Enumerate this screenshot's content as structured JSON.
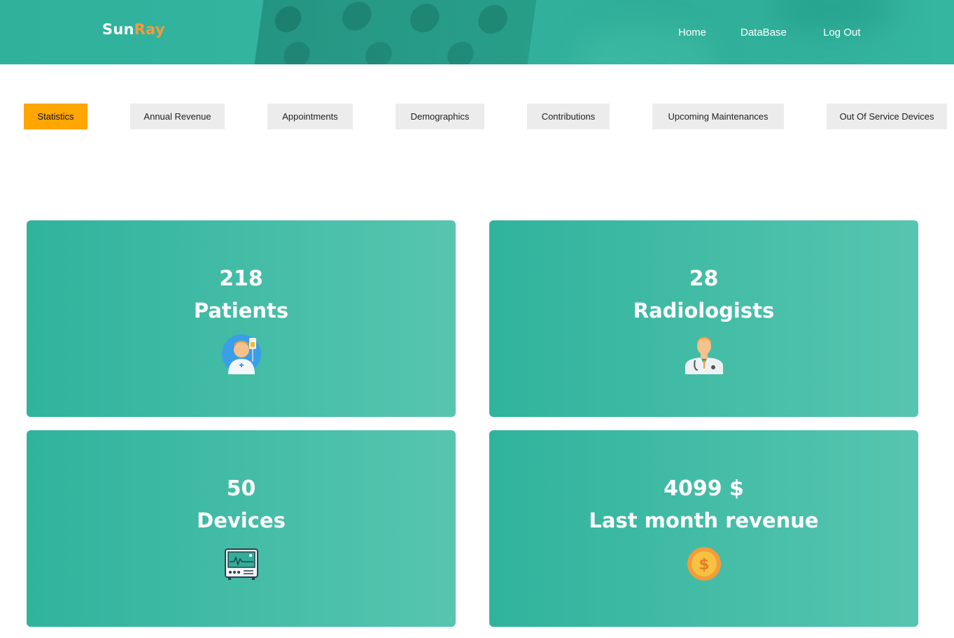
{
  "brand": {
    "part1": "Sun",
    "part2": "Ray"
  },
  "nav": {
    "home": "Home",
    "database": "DataBase",
    "logout": "Log Out"
  },
  "tabs": [
    {
      "label": "Statistics",
      "active": true
    },
    {
      "label": "Annual Revenue",
      "active": false
    },
    {
      "label": "Appointments",
      "active": false
    },
    {
      "label": "Demographics",
      "active": false
    },
    {
      "label": "Contributions",
      "active": false
    },
    {
      "label": "Upcoming Maintenances",
      "active": false
    },
    {
      "label": "Out Of Service Devices",
      "active": false
    }
  ],
  "cards": [
    {
      "value": "218",
      "label": "Patients",
      "icon": "patient-icon"
    },
    {
      "value": "28",
      "label": "Radiologists",
      "icon": "doctor-icon"
    },
    {
      "value": "50",
      "label": "Devices",
      "icon": "monitor-icon"
    },
    {
      "value": "4099 $",
      "label": "Last month revenue",
      "icon": "coin-icon"
    }
  ],
  "colors": {
    "accent": "#ffa600",
    "brand_teal": "#30b39c",
    "brand_orange": "#f39c3b"
  }
}
